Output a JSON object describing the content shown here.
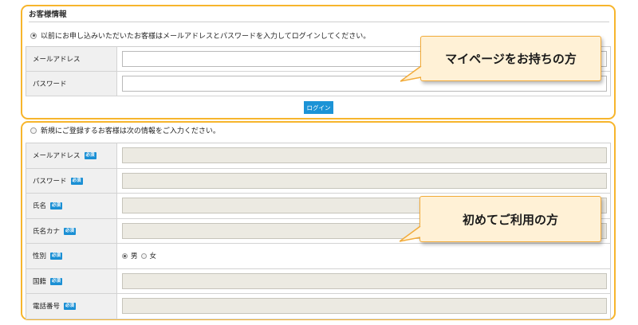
{
  "member": {
    "heading": "お客様情報",
    "radio_label": "以前にお申し込みいただいたお客様はメールアドレスとパスワードを入力してログインしてください。",
    "fields": [
      {
        "label": "メールアドレス",
        "value": ""
      },
      {
        "label": "パスワード",
        "value": ""
      }
    ],
    "login_label": "ログイン"
  },
  "guest": {
    "radio_label": "新規にご登録するお客様は次の情報をご入力ください。",
    "required_badge": "必須",
    "fields": [
      {
        "label": "メールアドレス"
      },
      {
        "label": "パスワード"
      },
      {
        "label": "氏名"
      },
      {
        "label": "氏名カナ"
      },
      {
        "label": "性別",
        "options": [
          "男",
          "女"
        ],
        "selected": "男"
      },
      {
        "label": "国籍"
      },
      {
        "label": "電話番号"
      }
    ]
  },
  "callouts": {
    "member": "マイページをお持ちの方",
    "guest": "初めてご利用の方"
  },
  "colors": {
    "frame": "#f7b52c",
    "callout_bg": "#fff1d6",
    "button": "#1c93d6",
    "badge": "#1a8fd4",
    "filled_input": "#eceae2"
  }
}
